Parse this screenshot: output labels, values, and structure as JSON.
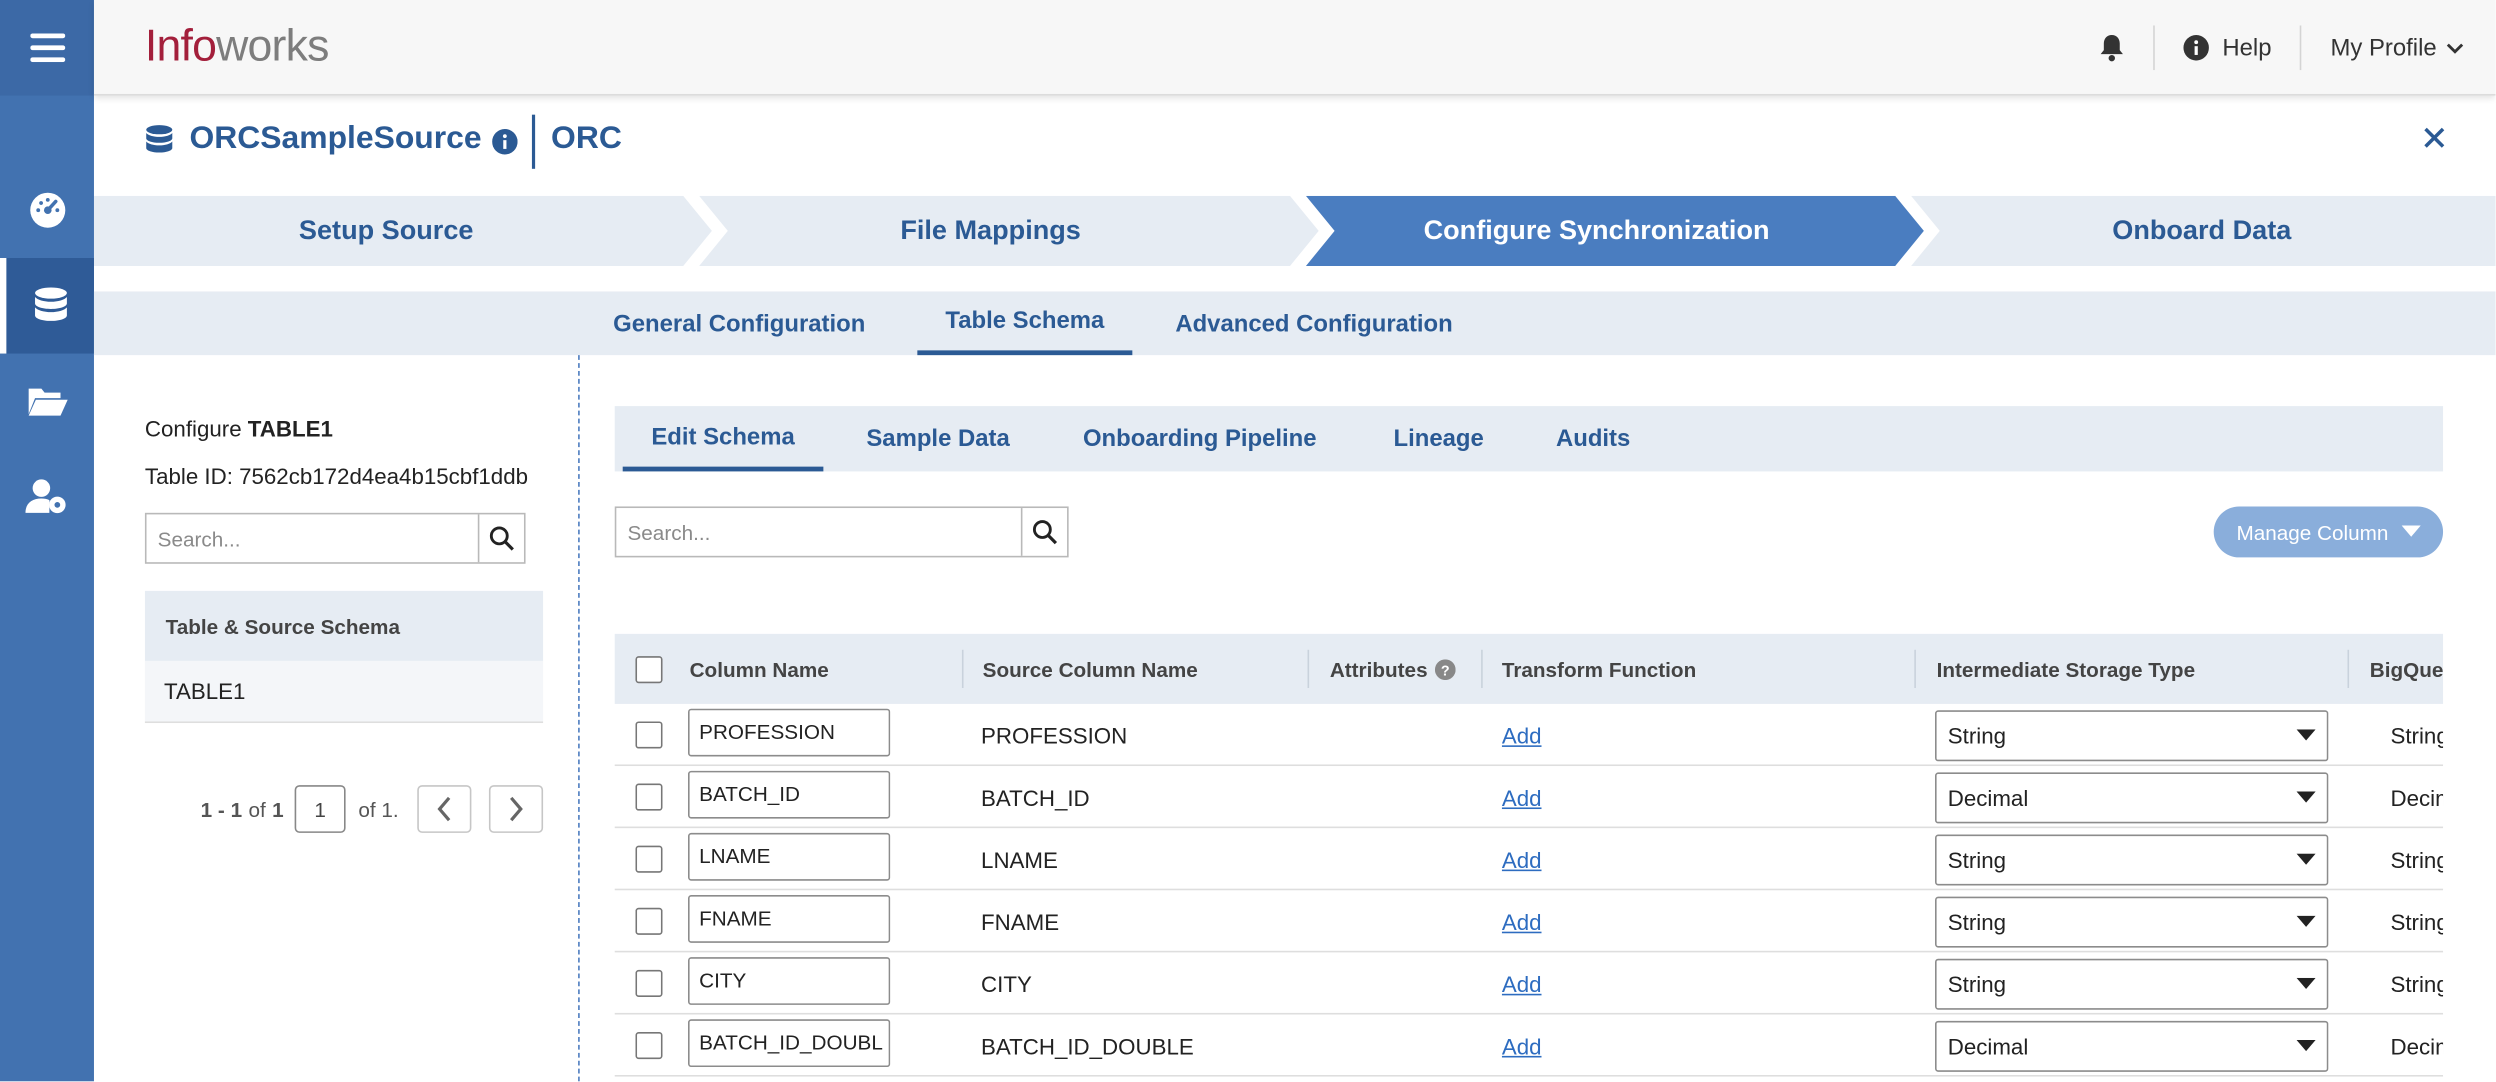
{
  "header": {
    "logo_part1": "Info",
    "logo_part2": "works",
    "help_label": "Help",
    "profile_label": "My Profile"
  },
  "sidebar": {
    "items": [
      {
        "icon": "dashboard-icon",
        "active": false
      },
      {
        "icon": "database-icon",
        "active": true
      },
      {
        "icon": "folder-icon",
        "active": false
      },
      {
        "icon": "user-settings-icon",
        "active": false
      }
    ]
  },
  "source": {
    "name": "ORCSampleSource",
    "type": "ORC"
  },
  "steps": [
    "Setup Source",
    "File Mappings",
    "Configure Synchronization",
    "Onboard Data"
  ],
  "subtabs": [
    "General Configuration",
    "Table Schema",
    "Advanced Configuration"
  ],
  "left": {
    "configure_prefix": "Configure",
    "table_name": "TABLE1",
    "table_id_label": "Table ID: 7562cb172d4ea4b15cbf1ddb",
    "search_placeholder": "Search...",
    "list_header": "Table & Source Schema",
    "list_item": "TABLE1",
    "pagination": {
      "range": "1 - 1",
      "of_label": "of",
      "total": "1",
      "page_value": "1",
      "of_pages": "of 1."
    }
  },
  "inner_tabs": [
    "Edit Schema",
    "Sample Data",
    "Onboarding Pipeline",
    "Lineage",
    "Audits"
  ],
  "main": {
    "search_placeholder": "Search...",
    "manage_column_label": "Manage Column"
  },
  "table": {
    "headers": {
      "column_name": "Column Name",
      "source_column_name": "Source Column Name",
      "attributes": "Attributes",
      "transform_function": "Transform Function",
      "storage_type": "Intermediate Storage Type",
      "bigquery": "BigQue"
    },
    "rows": [
      {
        "name": "PROFESSION",
        "source": "PROFESSION",
        "transform": "Add",
        "storage": "String",
        "bigquery": "String"
      },
      {
        "name": "BATCH_ID",
        "source": "BATCH_ID",
        "transform": "Add",
        "storage": "Decimal",
        "bigquery": "Decim"
      },
      {
        "name": "LNAME",
        "source": "LNAME",
        "transform": "Add",
        "storage": "String",
        "bigquery": "String"
      },
      {
        "name": "FNAME",
        "source": "FNAME",
        "transform": "Add",
        "storage": "String",
        "bigquery": "String"
      },
      {
        "name": "CITY",
        "source": "CITY",
        "transform": "Add",
        "storage": "String",
        "bigquery": "String"
      },
      {
        "name": "BATCH_ID_DOUBL",
        "source": "BATCH_ID_DOUBLE",
        "transform": "Add",
        "storage": "Decimal",
        "bigquery": "Decim"
      }
    ]
  }
}
